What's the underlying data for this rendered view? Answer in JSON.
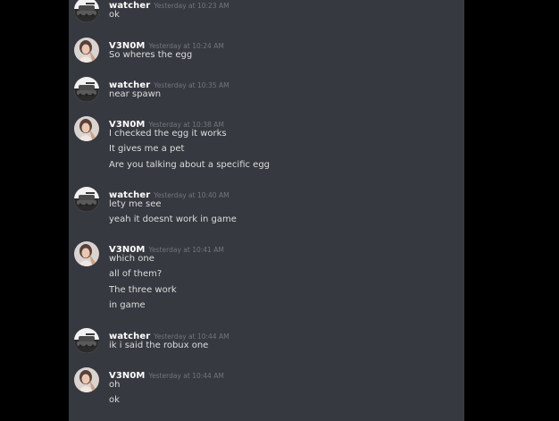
{
  "messages": [
    {
      "author": "watcher",
      "avatar": "tank-avatar-icon",
      "timestamp": "Yesterday at 10:23 AM",
      "lines": [
        "ok"
      ]
    },
    {
      "author": "V3N0M",
      "avatar": "girl-avatar-icon",
      "timestamp": "Yesterday at 10:24 AM",
      "lines": [
        "So wheres the egg"
      ]
    },
    {
      "author": "watcher",
      "avatar": "tank-avatar-icon",
      "timestamp": "Yesterday at 10:35 AM",
      "lines": [
        "near spawn"
      ]
    },
    {
      "author": "V3N0M",
      "avatar": "girl-avatar-icon",
      "timestamp": "Yesterday at 10:38 AM",
      "lines": [
        "I checked the egg it works",
        "It gives me a pet",
        "Are you talking about a specific egg"
      ]
    },
    {
      "author": "watcher",
      "avatar": "tank-avatar-icon",
      "timestamp": "Yesterday at 10:40 AM",
      "lines": [
        "lety me see",
        "yeah it doesnt work in game"
      ]
    },
    {
      "author": "V3N0M",
      "avatar": "girl-avatar-icon",
      "timestamp": "Yesterday at 10:41 AM",
      "lines": [
        "which one",
        "all of them?",
        "The three work",
        "in game"
      ]
    },
    {
      "author": "watcher",
      "avatar": "tank-avatar-icon",
      "timestamp": "Yesterday at 10:44 AM",
      "lines": [
        "ik i said the robux one"
      ]
    },
    {
      "author": "V3N0M",
      "avatar": "girl-avatar-icon",
      "timestamp": "Yesterday at 10:44 AM",
      "lines": [
        "oh",
        "ok"
      ]
    }
  ],
  "colors": {
    "chat_background": "#36393f",
    "outer_background": "#000000",
    "username": "#ffffff",
    "timestamp": "#72767d",
    "message_text": "#dcddde"
  }
}
